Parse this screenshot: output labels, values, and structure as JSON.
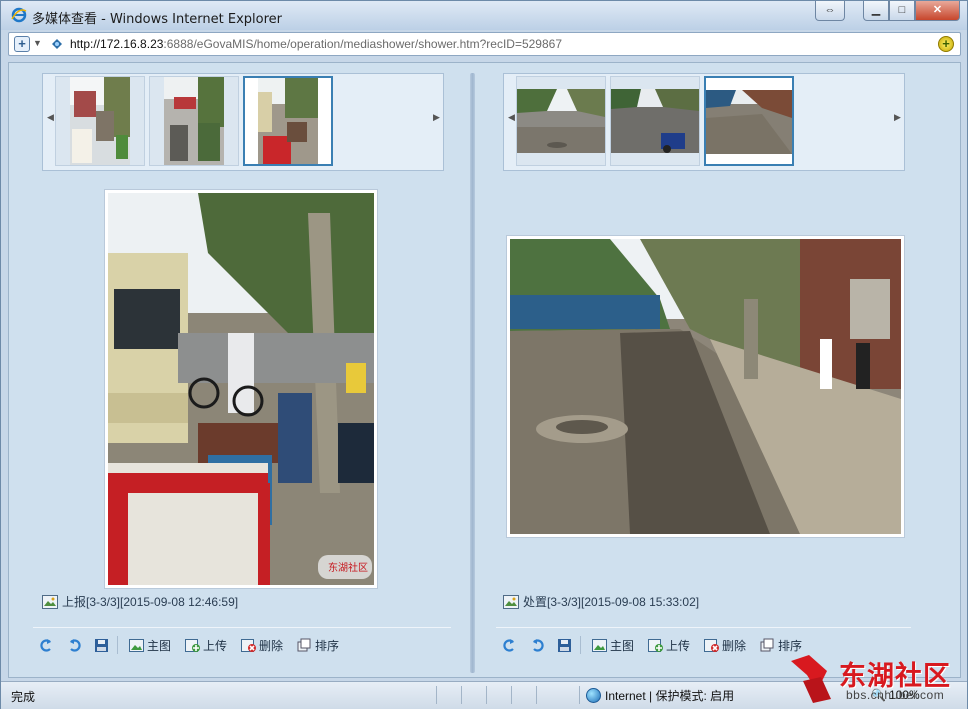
{
  "window": {
    "title": "多媒体查看 - Windows Internet Explorer",
    "address_host": "http://172.16.8.23",
    "address_rest": ":6888/eGovaMIS/home/operation/mediashower/shower.htm?recID=529867"
  },
  "left_panel": {
    "caption": "上报[3-3/3][2015-09-08 12:46:59]",
    "thumbnails": 3,
    "selected_thumbnail": 3
  },
  "right_panel": {
    "caption": "处置[3-3/3][2015-09-08 15:33:02]",
    "thumbnails": 3,
    "selected_thumbnail": 3
  },
  "toolbar": {
    "main_image": "主图",
    "upload": "上传",
    "delete": "删除",
    "sort": "排序"
  },
  "statusbar": {
    "status": "完成",
    "zone": "Internet | 保护模式: 启用",
    "zoom": "100%"
  },
  "watermark": {
    "brand": "东湖社区",
    "url": "bbs.cnhubei.com"
  },
  "photo_watermark": "东湖社区",
  "icons": {
    "rotate_left": "rotate-left-icon",
    "rotate_right": "rotate-right-icon",
    "save": "save-icon",
    "main_image": "image-icon",
    "upload": "upload-icon",
    "delete": "delete-icon",
    "sort": "sort-icon"
  }
}
